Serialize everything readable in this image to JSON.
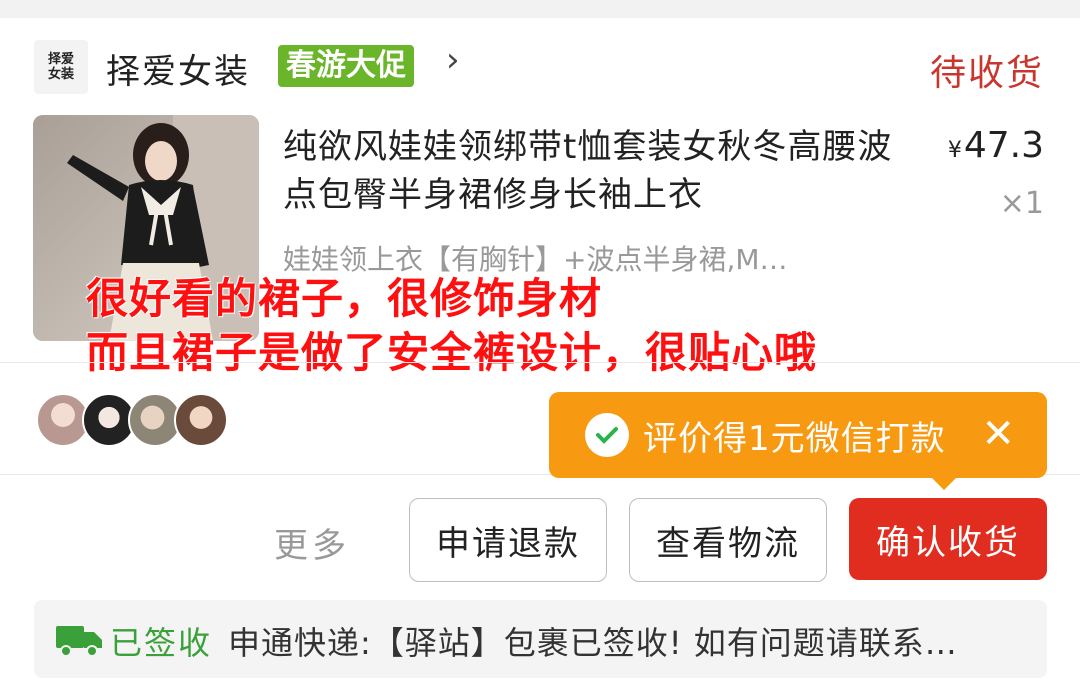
{
  "shop": {
    "logo_line1": "择爱",
    "logo_line2": "女装",
    "name": "择爱女装",
    "promo": "春游大促",
    "chevron": "›"
  },
  "order": {
    "status": "待收货"
  },
  "product": {
    "title": "纯欲风娃娃领绑带t恤套装女秋冬高腰波点包臀半身裙修身长袖上衣",
    "price_symbol": "¥",
    "price": "47.3",
    "quantity": "×1",
    "variant": "娃娃领上衣【有胸针】+波点半身裙,M…"
  },
  "review_overlay": {
    "line1": "很好看的裙子，很修饰身材",
    "line2": "而且裙子是做了安全裤设计，很贴心哦"
  },
  "reviewer_avatars": [
    "avatar-1",
    "avatar-2",
    "avatar-3",
    "avatar-4"
  ],
  "tooltip": {
    "text": "评价得1元微信打款",
    "close": "✕",
    "accent": "#f79a12"
  },
  "actions": {
    "more": "更多",
    "refund": "申请退款",
    "logistics": "查看物流",
    "confirm": "确认收货"
  },
  "logistics_info": {
    "status": "已签收",
    "detail": "申通快递:【驿站】包裹已签收! 如有问题请联系…"
  },
  "colors": {
    "status_red": "#c8372d",
    "confirm_red": "#e02d20",
    "promo_green": "#6bb52a",
    "signed_green": "#3aa13a"
  }
}
